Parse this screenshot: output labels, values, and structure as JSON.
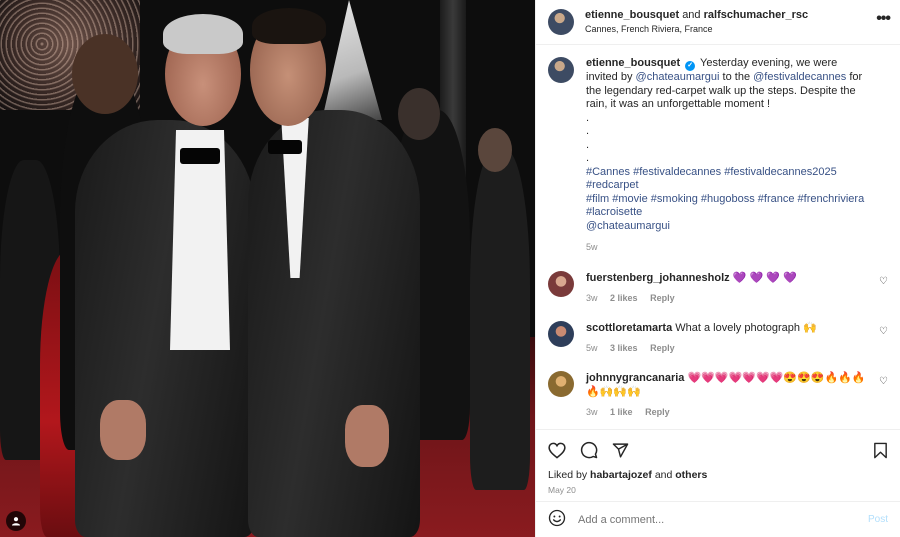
{
  "header": {
    "user1": "etienne_bousquet",
    "and_text": "and",
    "user2": "ralfschumacher_rsc",
    "location": "Cannes, French Riviera, France",
    "more_icon": "more-horizontal-icon"
  },
  "caption": {
    "username": "etienne_bousquet",
    "verified": true,
    "text_1": "Yesterday evening, we were invited by",
    "mention_1": "@chateaumargui",
    "text_2": "to the",
    "mention_2": "@festivaldecannes",
    "text_3": "for the legendary red-carpet walk up the steps. Despite the rain, it was an unforgettable moment !",
    "dots": [
      ".",
      ".",
      ".",
      "."
    ],
    "hashtags_1": "#Cannes #festivaldecannes #festivaldecannes2025 #redcarpet",
    "hashtags_2": "#film #movie #smoking #hugoboss #france #frenchriviera",
    "hashtags_3": "#lacroisette",
    "mention_3": "@chateaumargui",
    "age": "5w"
  },
  "comments": [
    {
      "username": "fuerstenberg_johanneshol z",
      "username_clean": "fuerstenberg_johannesholz",
      "text": "💜 💜 💜 💜",
      "age": "3w",
      "likes": "2 likes",
      "reply": "Reply"
    },
    {
      "username_clean": "scottloretamarta",
      "text": "What a lovely photograph 🙌",
      "age": "5w",
      "likes": "3 likes",
      "reply": "Reply"
    },
    {
      "username_clean": "johnnygrancanaria",
      "text": "💗💗💗💗💗💗💗😍😍😍🔥🔥🔥 🔥🙌🙌🙌",
      "age": "3w",
      "likes": "1 like",
      "reply": "Reply"
    }
  ],
  "actions": {
    "liked_by_prefix": "Liked by",
    "liked_by_user": "habartajozef",
    "liked_by_and": "and",
    "liked_by_others": "others",
    "date": "May 20",
    "icons": [
      "heart-icon",
      "comment-icon",
      "share-icon",
      "bookmark-icon"
    ]
  },
  "add_comment": {
    "placeholder": "Add a comment...",
    "post_label": "Post"
  },
  "colors": {
    "link": "#385185",
    "muted": "#8e8e8e",
    "verified": "#0095f6",
    "post_disabled": "#b2dffc"
  }
}
